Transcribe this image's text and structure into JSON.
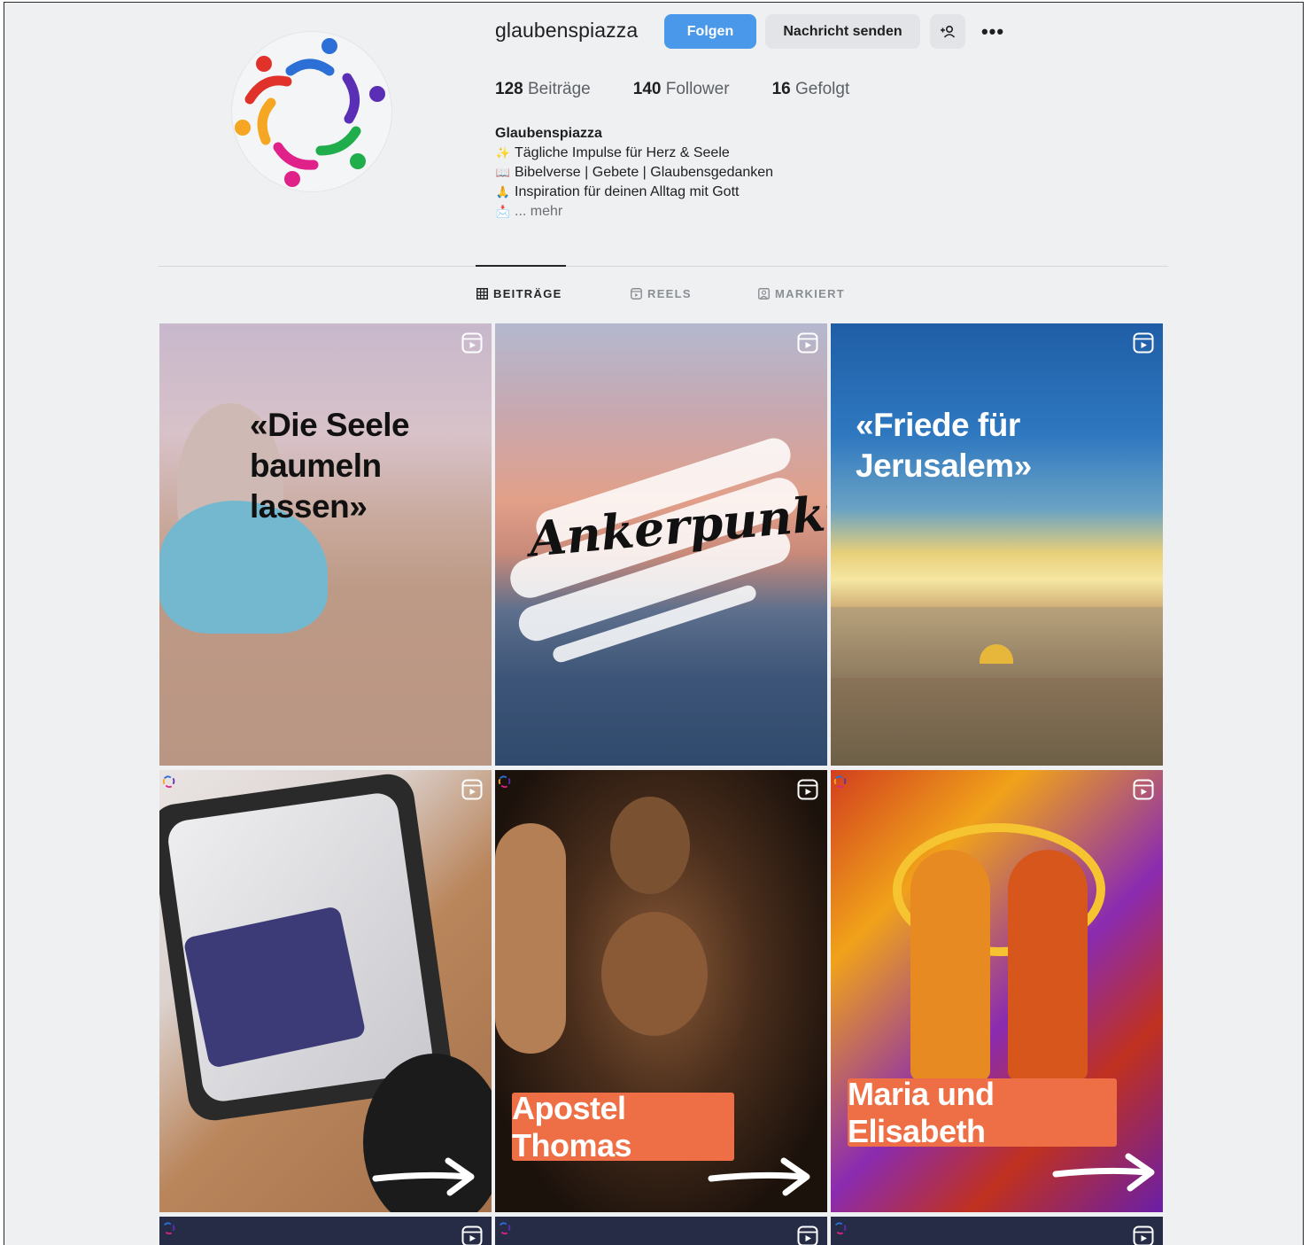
{
  "profile": {
    "username": "glaubenspiazza",
    "follow_label": "Folgen",
    "message_label": "Nachricht senden",
    "more_label": "•••",
    "stats": [
      {
        "value": "128",
        "label": "Beiträge"
      },
      {
        "value": "140",
        "label": "Follower"
      },
      {
        "value": "16",
        "label": "Gefolgt"
      }
    ],
    "bio": {
      "name": "Glaubenspiazza",
      "lines": [
        {
          "emoji": "✨",
          "text": "Tägliche Impulse für Herz & Seele"
        },
        {
          "emoji": "📖",
          "text": "Bibelverse | Gebete | Glaubensgedanken"
        },
        {
          "emoji": "🙏",
          "text": "Inspiration für deinen Alltag mit Gott"
        }
      ],
      "more_prefix_emoji": "📩",
      "more_label": "... mehr"
    }
  },
  "tabs": [
    {
      "label": "BEITRÄGE",
      "icon": "grid-icon",
      "active": true
    },
    {
      "label": "REELS",
      "icon": "reels-icon",
      "active": false
    },
    {
      "label": "MARKIERT",
      "icon": "tagged-icon",
      "active": false
    }
  ],
  "posts": [
    {
      "title": "«Die Seele baumeln lassen»",
      "line1": "«Die Seele",
      "line2": "baumeln lassen»",
      "type": "reel"
    },
    {
      "title": "Ankerpunkt",
      "type": "reel"
    },
    {
      "title": "«Friede für Jerusalem»",
      "line1": "«Friede für",
      "line2": "Jerusalem»",
      "type": "reel"
    },
    {
      "title": "",
      "type": "reel"
    },
    {
      "title": "Apostel Thomas",
      "type": "reel"
    },
    {
      "title": "Maria und Elisabeth",
      "type": "reel"
    },
    {
      "title": "",
      "type": "reel"
    },
    {
      "title": "",
      "type": "reel"
    },
    {
      "title": "",
      "type": "reel"
    }
  ],
  "colors": {
    "follow_button": "#4a98ea",
    "secondary_button": "#e2e4e7",
    "label_orange": "#ee6f45",
    "page_background": "#eef0f2"
  }
}
